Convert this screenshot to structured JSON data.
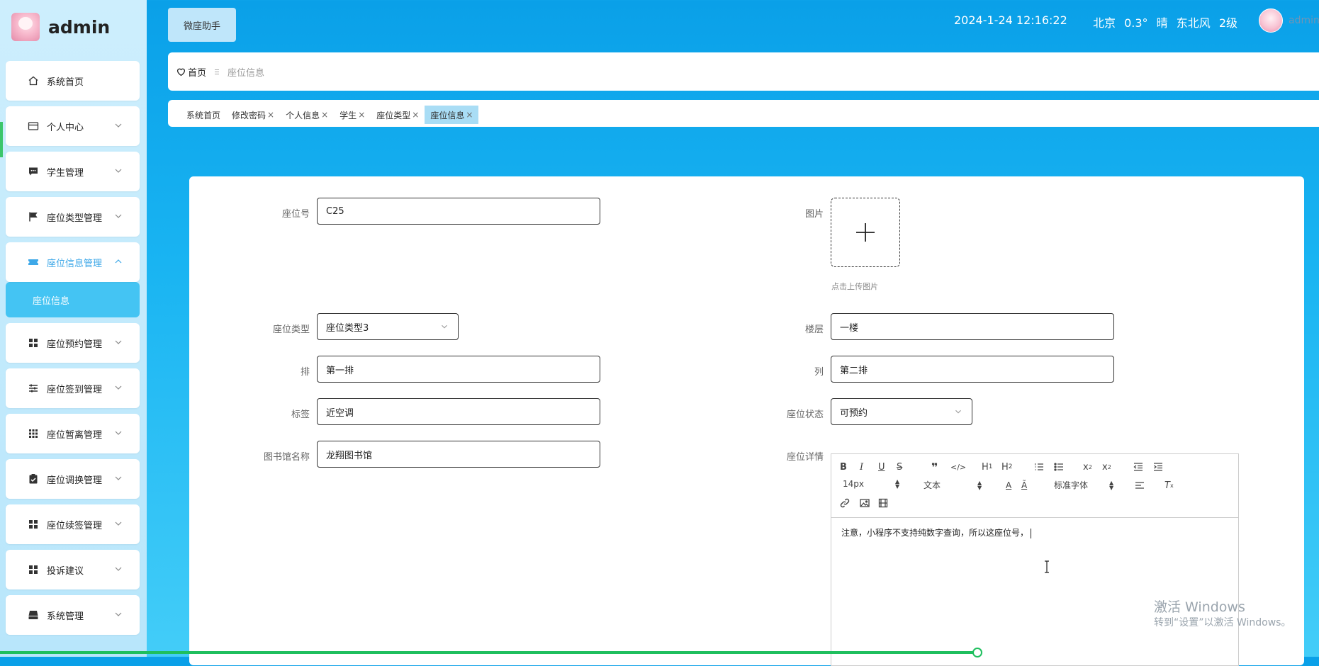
{
  "brand": {
    "name": "admin"
  },
  "sidebar": {
    "items": [
      {
        "label": "系统首页",
        "icon": "home-icon"
      },
      {
        "label": "个人中心",
        "icon": "card-icon"
      },
      {
        "label": "学生管理",
        "icon": "chat-icon"
      },
      {
        "label": "座位类型管理",
        "icon": "flag-icon"
      },
      {
        "label": "座位信息管理",
        "icon": "ticket-icon",
        "active": true
      },
      {
        "label": "座位预约管理",
        "icon": "grid-icon"
      },
      {
        "label": "座位签到管理",
        "icon": "sliders-icon"
      },
      {
        "label": "座位暂离管理",
        "icon": "dots-grid-icon"
      },
      {
        "label": "座位调换管理",
        "icon": "clipboard-check-icon"
      },
      {
        "label": "座位续签管理",
        "icon": "grid-icon"
      },
      {
        "label": "投诉建议",
        "icon": "grid-icon"
      },
      {
        "label": "系统管理",
        "icon": "archive-icon"
      }
    ],
    "sub_item": "座位信息"
  },
  "header": {
    "assistant_label": "微座助手",
    "datetime": "2024-1-24 12:16:22",
    "weather": {
      "city": "北京",
      "temp": "0.3°",
      "condition": "晴",
      "wind": "东北风",
      "level": "2级"
    },
    "user": "admin"
  },
  "breadcrumb": {
    "home": "首页",
    "current": "座位信息"
  },
  "tabs": [
    {
      "label": "系统首页",
      "closable": false
    },
    {
      "label": "修改密码",
      "closable": true
    },
    {
      "label": "个人信息",
      "closable": true
    },
    {
      "label": "学生",
      "closable": true
    },
    {
      "label": "座位类型",
      "closable": true
    },
    {
      "label": "座位信息",
      "closable": true,
      "active": true
    }
  ],
  "form": {
    "seat_no": {
      "label": "座位号",
      "value": "C25"
    },
    "image": {
      "label": "图片",
      "hint": "点击上传图片"
    },
    "seat_type": {
      "label": "座位类型",
      "value": "座位类型3"
    },
    "floor": {
      "label": "楼层",
      "value": "一楼"
    },
    "row": {
      "label": "排",
      "value": "第一排"
    },
    "col": {
      "label": "列",
      "value": "第二排"
    },
    "tag": {
      "label": "标签",
      "value": "近空调"
    },
    "seat_status": {
      "label": "座位状态",
      "value": "可预约"
    },
    "library": {
      "label": "图书馆名称",
      "value": "龙翔图书馆"
    },
    "detail": {
      "label": "座位详情",
      "font_size": "14px",
      "block_type": "文本",
      "font_family": "标准字体",
      "content": "注意，小程序不支持纯数字查询，所以这座位号，"
    }
  },
  "watermark": {
    "line1": "激活 Windows",
    "line2": "转到“设置”以激活 Windows。"
  },
  "colors": {
    "accent": "#3ea8e8",
    "submenu_bg": "#44c4f3",
    "active_tab": "#a9ddf5"
  }
}
